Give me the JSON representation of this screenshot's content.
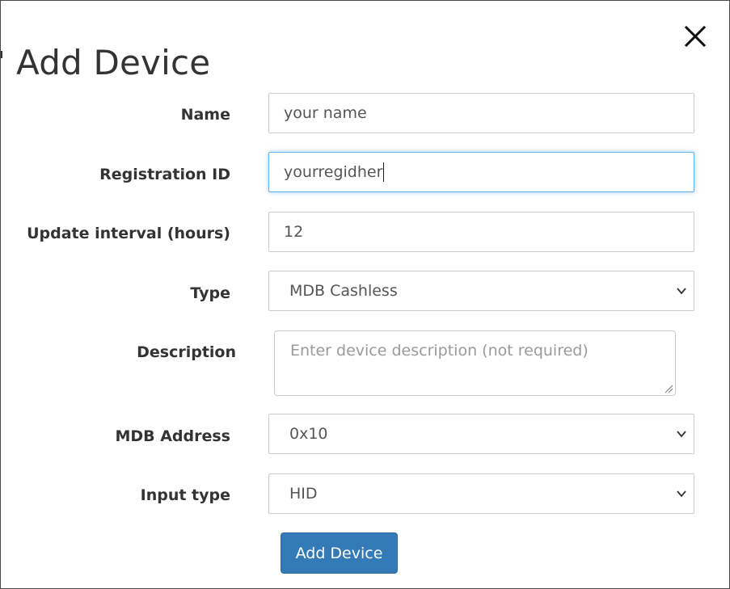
{
  "modal": {
    "title": "Add Device",
    "close_icon": "close-icon"
  },
  "form": {
    "name": {
      "label": "Name",
      "value": "your name"
    },
    "registration_id": {
      "label": "Registration ID",
      "value": "yourregidher"
    },
    "update_interval": {
      "label": "Update interval (hours)",
      "value": "12"
    },
    "type": {
      "label": "Type",
      "selected": "MDB Cashless"
    },
    "description": {
      "label": "Description",
      "placeholder": "Enter device description (not required)",
      "value": ""
    },
    "mdb_address": {
      "label": "MDB Address",
      "selected": "0x10"
    },
    "input_type": {
      "label": "Input type",
      "selected": "HID"
    },
    "submit_label": "Add Device"
  },
  "colors": {
    "primary_button": "#337ab7",
    "focus_border": "#66afe9",
    "text": "#333333"
  },
  "icons": [
    "close-icon",
    "chevron-down-icon",
    "resize-grip-icon"
  ]
}
